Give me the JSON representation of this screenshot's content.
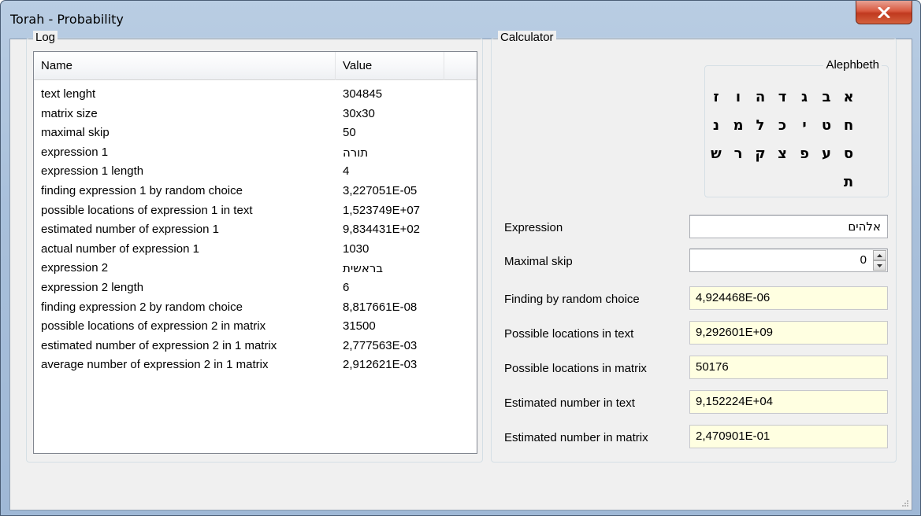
{
  "window": {
    "title": "Torah - Probability"
  },
  "log": {
    "group_title": "Log",
    "columns": [
      "Name",
      "Value"
    ],
    "rows": [
      {
        "name": "text lenght",
        "value": "304845"
      },
      {
        "name": "matrix size",
        "value": "30x30"
      },
      {
        "name": "maximal skip",
        "value": "50"
      },
      {
        "name": "expression 1",
        "value": "תורה"
      },
      {
        "name": "expression 1 length",
        "value": "4"
      },
      {
        "name": "finding expression 1 by random choice",
        "value": "3,227051E-05"
      },
      {
        "name": "possible locations of expression 1 in text",
        "value": "1,523749E+07"
      },
      {
        "name": "estimated number of expression 1",
        "value": "9,834431E+02"
      },
      {
        "name": "actual number of expression 1",
        "value": "1030"
      },
      {
        "name": "expression 2",
        "value": "בראשית"
      },
      {
        "name": "expression 2 length",
        "value": "6"
      },
      {
        "name": "finding expression 2 by random choice",
        "value": "8,817661E-08"
      },
      {
        "name": "possible locations of expression 2 in matrix",
        "value": "31500"
      },
      {
        "name": "estimated number of expression 2 in 1 matrix",
        "value": "2,777563E-03"
      },
      {
        "name": "average number of expression 2 in 1 matrix",
        "value": "2,912621E-03"
      }
    ]
  },
  "calculator": {
    "group_title": "Calculator",
    "alephbeth": {
      "title": "Alephbeth",
      "letters": [
        "א",
        "ב",
        "ג",
        "ד",
        "ה",
        "ו",
        "ז",
        "ח",
        "ט",
        "י",
        "כ",
        "ל",
        "מ",
        "נ",
        "ס",
        "ע",
        "פ",
        "צ",
        "ק",
        "ר",
        "ש",
        "ת"
      ]
    },
    "expression": {
      "label": "Expression",
      "value": "אלהים"
    },
    "maximal_skip": {
      "label": "Maximal skip",
      "value": "0"
    },
    "finding_random": {
      "label": "Finding by random choice",
      "value": "4,924468E-06"
    },
    "locations_text": {
      "label": "Possible locations in text",
      "value": "9,292601E+09"
    },
    "locations_matrix": {
      "label": "Possible locations in matrix",
      "value": "50176"
    },
    "estimated_text": {
      "label": "Estimated number in text",
      "value": "9,152224E+04"
    },
    "estimated_matrix": {
      "label": "Estimated number in matrix",
      "value": "2,470901E-01"
    }
  },
  "colors": {
    "readonly_field": "#ffffe1",
    "close_button": "#c9482c",
    "title_bar": "#b4cae2"
  }
}
